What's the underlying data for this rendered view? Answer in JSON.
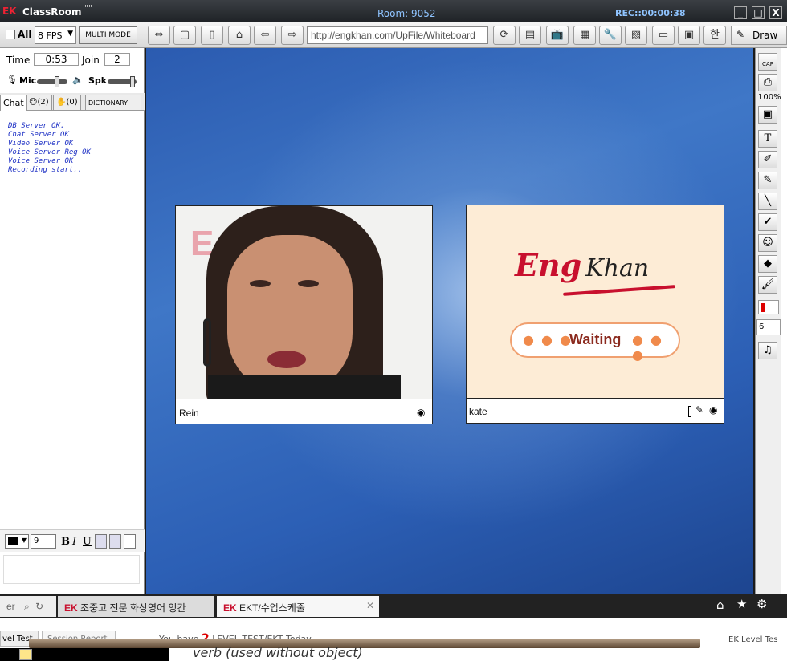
{
  "titlebar": {
    "logo": "EK",
    "app_name": "ClassRoom",
    "dots": "\"\"",
    "room": "Room: 9052",
    "rec": "REC::00:00:38",
    "min": "_",
    "max": "□",
    "close": "X"
  },
  "toolbar": {
    "all_label": "All",
    "fps": "8 FPS",
    "multi_mode": "MULTI MODE",
    "url": "http://engkhan.com/UpFile/Whiteboard",
    "draw_label": "Draw",
    "hangul_label": "한"
  },
  "left": {
    "time_label": "Time",
    "time_value": "0:53",
    "join_label": "Join",
    "join_value": "2",
    "mic_label": "Mic",
    "spk_label": "Spk",
    "tabs": {
      "chat": "Chat",
      "users_count": "(2)",
      "hands_count": "(0)",
      "dictionary": "DICTIONARY"
    },
    "chat_log": [
      "DB Server OK.",
      "Chat Server OK",
      "Video Server OK",
      "Voice Server Reg OK",
      "Voice Server OK",
      "Recording start.."
    ],
    "font_size": "9",
    "bold": "B",
    "italic": "I",
    "underline": "U"
  },
  "videos": [
    {
      "name": "Rein",
      "bg_text": "E  AN."
    },
    {
      "name": "kate",
      "logo_eng": "Eng",
      "logo_khan": "Khan",
      "status": "Waiting"
    }
  ],
  "right_tools": {
    "zoom": "100%",
    "pen_size": "6",
    "cap_label": "CAP"
  },
  "browser_tabs": [
    {
      "label": "조중고 전문 화상영어 잉칸",
      "logo": "EK"
    },
    {
      "label": "EKT/수업스케줄",
      "logo": "EK"
    }
  ],
  "browser_search": "er",
  "bottom": {
    "tab1": "vel Test",
    "tab2": "Session Report",
    "notice_prefix": "You have",
    "notice_count": "2",
    "notice_suffix": "LEVEL TEST/EKT Today",
    "verb_text": "verb (used without object)",
    "right_label": "EK Level Tes"
  },
  "colors": {
    "brand_red": "#c8102e",
    "accent_blue": "#2c5fb5",
    "waiting_orange": "#f08a4b"
  }
}
